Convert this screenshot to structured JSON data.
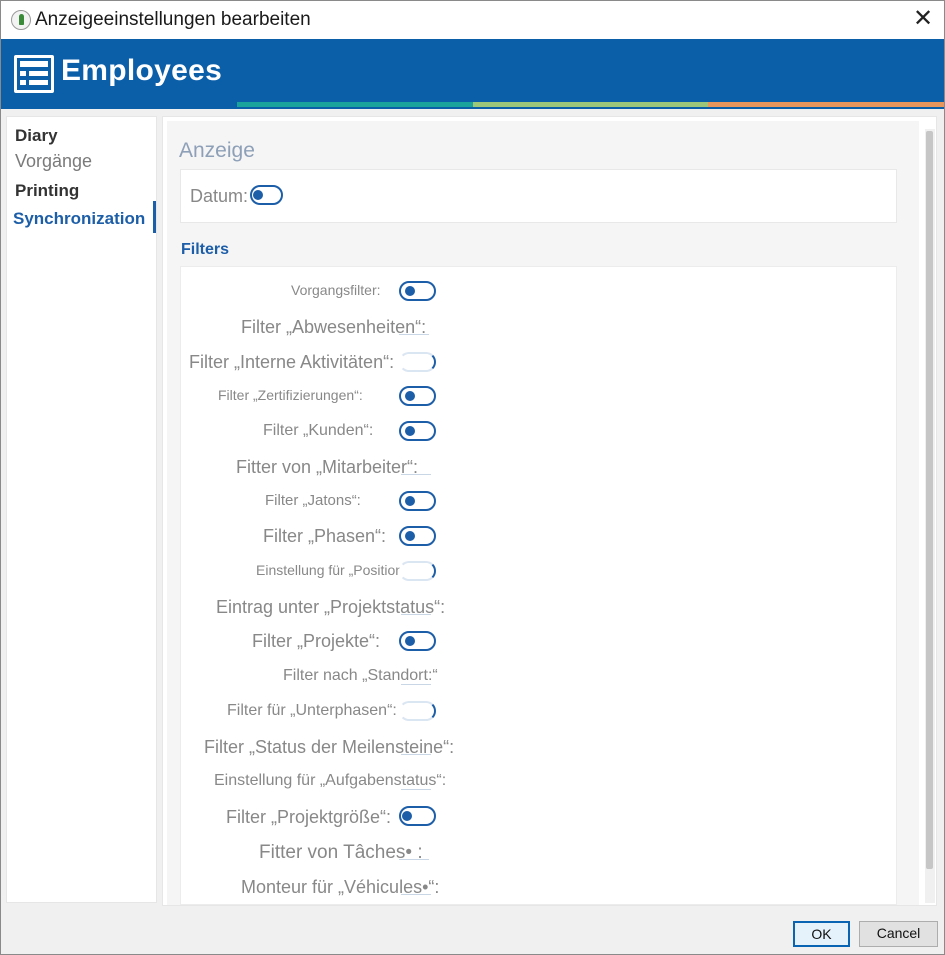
{
  "window": {
    "title": "Anzeigeeinstellungen bearbeiten",
    "close_glyph": "✕",
    "icon": "app-leaf-icon"
  },
  "banner": {
    "title": "Employees",
    "icon": "table-list-icon",
    "background": "#0b5ea8",
    "stripe_colors": [
      "#1aa39c",
      "#9cc77a",
      "#e8965c"
    ]
  },
  "sidebar": {
    "items": [
      {
        "label": "Diary",
        "style": "bold"
      },
      {
        "label": "Vorgänge",
        "style": "muted"
      },
      {
        "label": "Printing",
        "style": "bold"
      },
      {
        "label": "Synchronization",
        "style": "active"
      }
    ]
  },
  "main": {
    "section_title": "Anzeige",
    "datum_label": "Datum:",
    "filters_title": "Filters",
    "filters": [
      {
        "label": "Vorgangsfilter:",
        "state": "on"
      },
      {
        "label": "Filter „Abwesenheiten“:",
        "state": "stub"
      },
      {
        "label": "Filter „Interne Aktivitäten“:",
        "state": "partial"
      },
      {
        "label": "Filter „Zertifizierungen“:",
        "state": "on"
      },
      {
        "label": "Filter „Kunden“:",
        "state": "on"
      },
      {
        "label": "Fitter von „Mitarbeiter“:",
        "state": "stub"
      },
      {
        "label": "Filter „Jatons“:",
        "state": "on"
      },
      {
        "label": "Filter „Phasen“:",
        "state": "on"
      },
      {
        "label": "Einstellung für „Position“:",
        "state": "partial"
      },
      {
        "label": "Eintrag unter „Projektstatus“:",
        "state": "stub"
      },
      {
        "label": "Filter „Projekte“:",
        "state": "on"
      },
      {
        "label": "Filter nach „Standort:“",
        "state": "stub"
      },
      {
        "label": "Filter für „Unterphasen“:",
        "state": "partial"
      },
      {
        "label": "Filter „Status der Meilensteine“:",
        "state": "stub"
      },
      {
        "label": "Einstellung für „Aufgabenstatus“:",
        "state": "stub"
      },
      {
        "label": "Filter „Projektgröße“:",
        "state": "on"
      },
      {
        "label": "Fitter von Tâches• :",
        "state": "stub"
      },
      {
        "label": "Monteur für „Véhicules•“:",
        "state": "stub"
      }
    ]
  },
  "buttons": {
    "ok": "OK",
    "cancel": "Cancel"
  },
  "colors": {
    "accent": "#1d5ea8",
    "label_gray": "#888888",
    "section_title": "#8ea0b8"
  }
}
